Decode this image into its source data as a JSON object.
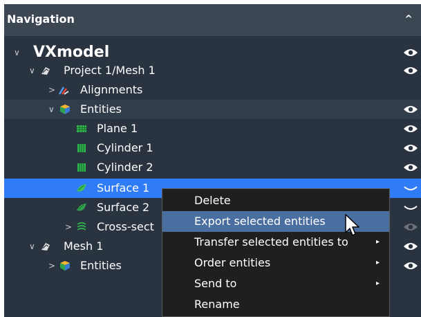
{
  "header": {
    "title": "Navigation",
    "collapse_glyph": "^",
    "collapse_icon": "chevron-up-icon"
  },
  "tree": {
    "root_label": "VXmodel",
    "project_label": "Project 1/Mesh 1",
    "alignments_label": "Alignments",
    "entities_label": "Entities",
    "plane1_label": "Plane 1",
    "cylinder1_label": "Cylinder 1",
    "cylinder2_label": "Cylinder 2",
    "surface1_label": "Surface 1",
    "surface2_label": "Surface 2",
    "crosssect_label": "Cross-sect",
    "mesh1_label": "Mesh 1",
    "mesh1_entities_label": "Entities"
  },
  "context_menu": {
    "items": [
      {
        "label": "Delete",
        "has_submenu": false
      },
      {
        "label": "Export selected entities",
        "has_submenu": false,
        "highlighted": true
      },
      {
        "label": "Transfer selected entities to",
        "has_submenu": true
      },
      {
        "label": "Order entities",
        "has_submenu": true
      },
      {
        "label": "Send to",
        "has_submenu": true
      },
      {
        "label": "Rename",
        "has_submenu": false
      }
    ],
    "submenu_glyph": "▸"
  },
  "colors": {
    "panel_bg": "#2a3340",
    "header_bg": "#3d4653",
    "selection": "#2f7cf6",
    "menu_bg": "#1f1f1f",
    "menu_highlight": "#4b6ea0"
  }
}
